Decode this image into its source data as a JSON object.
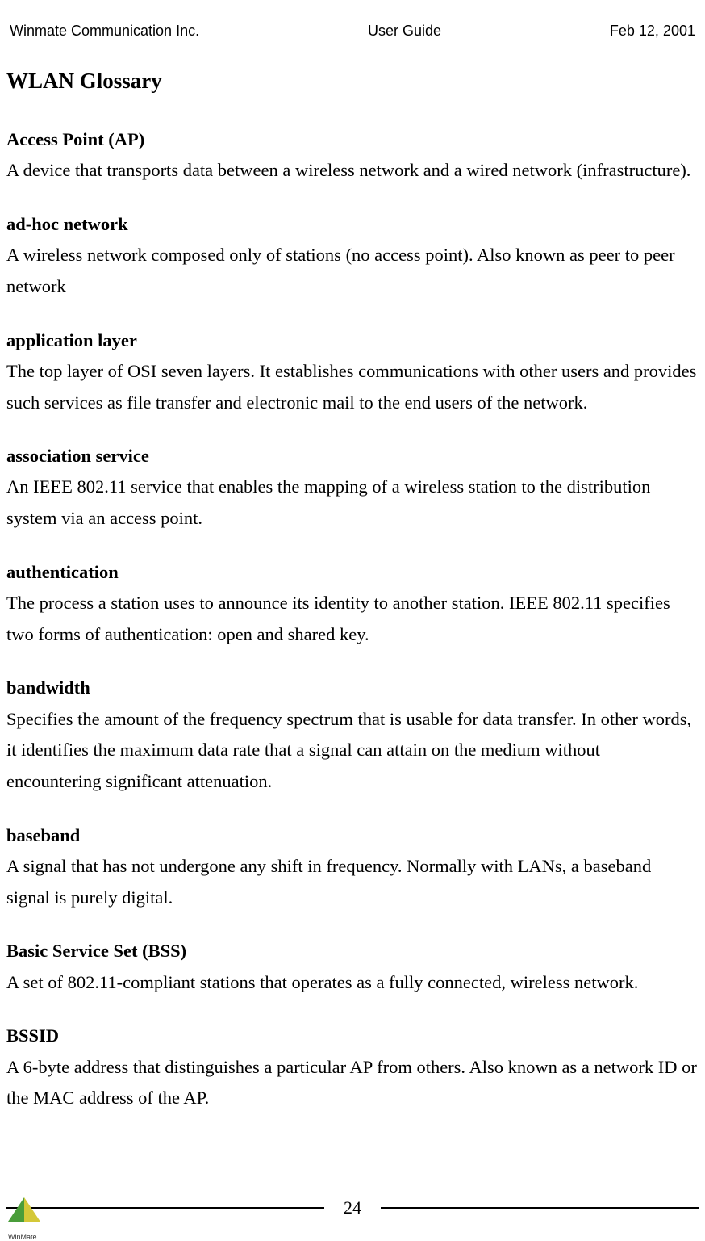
{
  "header": {
    "company": "Winmate Communication Inc.",
    "title": "User Guide",
    "date": "Feb 12, 2001"
  },
  "main_heading": "WLAN Glossary",
  "entries": [
    {
      "term": "Access Point (AP)",
      "definition": "A device that transports data between a wireless network and a wired network (infrastructure)."
    },
    {
      "term": "ad-hoc network",
      "definition": "A wireless network composed only of stations (no access point). Also known as peer to peer network"
    },
    {
      "term": "application layer",
      "definition": "The top layer of OSI seven layers. It establishes communications with other users and provides such services as file transfer and electronic mail to the end users of the network."
    },
    {
      "term": "association service",
      "definition": "An IEEE 802.11 service that enables the mapping of a wireless station to the distribution system via an access point."
    },
    {
      "term": "authentication",
      "definition": "The process a station uses to announce its identity to another station. IEEE 802.11 specifies two forms of authentication: open and shared key."
    },
    {
      "term": "bandwidth",
      "definition": "Specifies the amount of the frequency spectrum that is usable for data transfer. In other words, it identifies the maximum data rate that a signal can attain on the medium without encountering significant attenuation."
    },
    {
      "term": "baseband",
      "definition": "A signal that has not undergone any shift in frequency. Normally with LANs, a baseband signal is purely digital."
    },
    {
      "term": "Basic Service Set (BSS)",
      "definition": "A set of 802.11-compliant stations that operates as a fully connected, wireless network."
    },
    {
      "term": "BSSID",
      "definition": "A 6-byte address that distinguishes a particular AP from others. Also known as a network ID or the MAC address of the AP."
    }
  ],
  "footer": {
    "page_number": "24",
    "logo_text": "WinMate"
  }
}
